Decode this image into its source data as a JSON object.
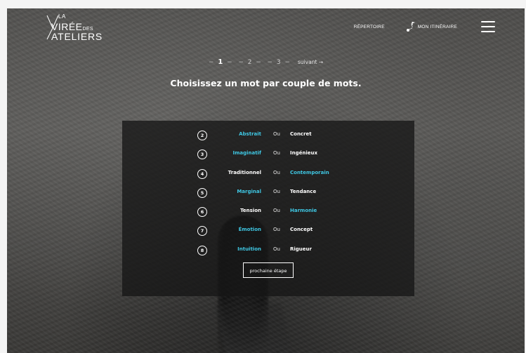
{
  "header": {
    "logo": {
      "la": "LA",
      "viree": "VIRÉE",
      "des": "DES",
      "ateliers": "ATELIERS"
    },
    "nav": {
      "repertoire": "RÉPERTOIRE",
      "itineraire": "MON ITINÉRAIRE"
    }
  },
  "stepper": {
    "steps": [
      "1",
      "2",
      "3"
    ],
    "active_step": 1,
    "next_label": "suivant →"
  },
  "heading": "Choisissez un mot par couple de mots.",
  "colors": {
    "accent": "#3fc7e3",
    "text": "#ffffff",
    "card_bg": "#161616"
  },
  "pairs": [
    {
      "num": "2",
      "left": "Abstrait",
      "or": "Ou",
      "right": "Concret",
      "selected": "left"
    },
    {
      "num": "3",
      "left": "Imaginatif",
      "or": "Ou",
      "right": "Ingénieux",
      "selected": "left"
    },
    {
      "num": "4",
      "left": "Traditionnel",
      "or": "Ou",
      "right": "Contemporain",
      "selected": "right"
    },
    {
      "num": "5",
      "left": "Marginal",
      "or": "Ou",
      "right": "Tendance",
      "selected": "left"
    },
    {
      "num": "6",
      "left": "Tension",
      "or": "Ou",
      "right": "Harmonie",
      "selected": "right"
    },
    {
      "num": "7",
      "left": "Émotion",
      "or": "Ou",
      "right": "Concept",
      "selected": "left"
    },
    {
      "num": "8",
      "left": "Intuition",
      "or": "Ou",
      "right": "Rigueur",
      "selected": "left"
    }
  ],
  "next_step_button": "prochaine étape"
}
